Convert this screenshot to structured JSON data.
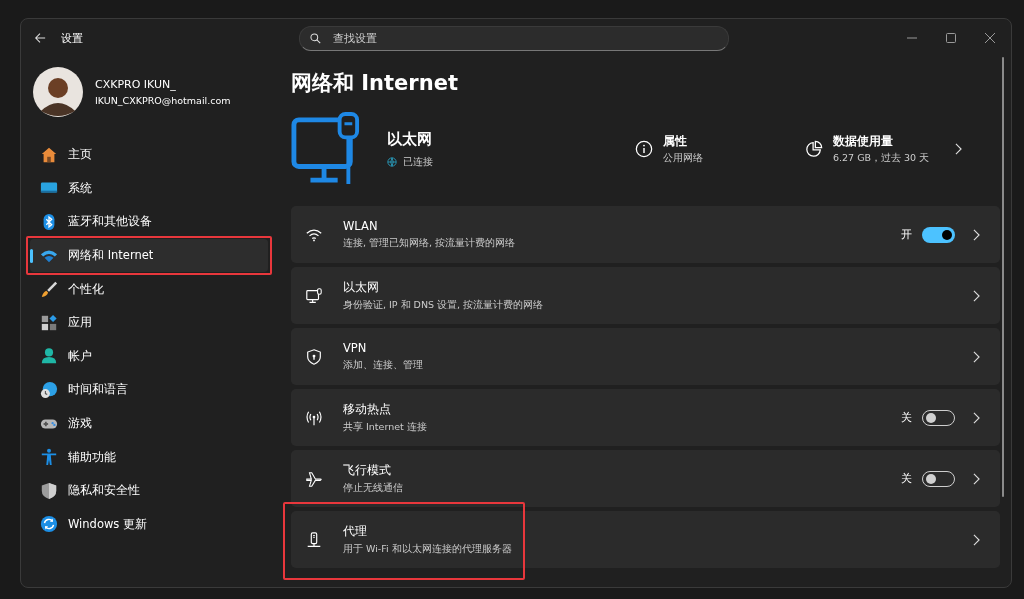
{
  "window": {
    "title": "设置",
    "search": {
      "placeholder": "查找设置"
    }
  },
  "account": {
    "name": "CXKPRO IKUN_",
    "email": "IKUN_CXKPRO@hotmail.com"
  },
  "sidebar": {
    "items": [
      {
        "label": "主页",
        "selected": false,
        "highlighted": false
      },
      {
        "label": "系统",
        "selected": false,
        "highlighted": false
      },
      {
        "label": "蓝牙和其他设备",
        "selected": false,
        "highlighted": false
      },
      {
        "label": "网络和 Internet",
        "selected": true,
        "highlighted": true
      },
      {
        "label": "个性化",
        "selected": false,
        "highlighted": false
      },
      {
        "label": "应用",
        "selected": false,
        "highlighted": false
      },
      {
        "label": "帐户",
        "selected": false,
        "highlighted": false
      },
      {
        "label": "时间和语言",
        "selected": false,
        "highlighted": false
      },
      {
        "label": "游戏",
        "selected": false,
        "highlighted": false
      },
      {
        "label": "辅助功能",
        "selected": false,
        "highlighted": false
      },
      {
        "label": "隐私和安全性",
        "selected": false,
        "highlighted": false
      },
      {
        "label": "Windows 更新",
        "selected": false,
        "highlighted": false
      }
    ]
  },
  "page": {
    "title": "网络和 Internet"
  },
  "connection": {
    "name": "以太网",
    "status": "已连接"
  },
  "properties": {
    "title": "属性",
    "value": "公用网络"
  },
  "data_usage": {
    "title": "数据使用量",
    "value": "6.27 GB，过去 30 天"
  },
  "rows": [
    {
      "kind": "toggle",
      "title": "WLAN",
      "subtitle": "连接, 管理已知网络, 按流量计费的网络",
      "state_label": "开",
      "on": true,
      "highlighted": false
    },
    {
      "kind": "link",
      "title": "以太网",
      "subtitle": "身份验证, IP 和 DNS 设置, 按流量计费的网络",
      "highlighted": false
    },
    {
      "kind": "link",
      "title": "VPN",
      "subtitle": "添加、连接、管理",
      "highlighted": false
    },
    {
      "kind": "toggle",
      "title": "移动热点",
      "subtitle": "共享 Internet 连接",
      "state_label": "关",
      "on": false,
      "highlighted": false
    },
    {
      "kind": "toggle",
      "title": "飞行模式",
      "subtitle": "停止无线通信",
      "state_label": "关",
      "on": false,
      "highlighted": false
    },
    {
      "kind": "link",
      "title": "代理",
      "subtitle": "用于 Wi-Fi 和以太网连接的代理服务器",
      "highlighted": true
    }
  ]
}
